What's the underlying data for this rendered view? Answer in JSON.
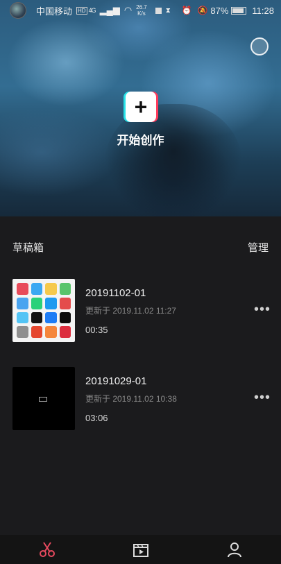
{
  "status_bar": {
    "carrier": "中国移动",
    "network_badge": "HD",
    "signal": "4G",
    "speed_value": "26.7",
    "speed_unit": "K/s",
    "battery": "87%",
    "battery_level": 0.87,
    "time": "11:28"
  },
  "hero": {
    "create_icon": "plus-icon",
    "create_label": "开始创作",
    "theme_icon": "moon-icon"
  },
  "drafts": {
    "title": "草稿箱",
    "manage_label": "管理",
    "items": [
      {
        "name": "20191102-01",
        "updated": "更新于 2019.11.02 11:27",
        "duration": "00:35"
      },
      {
        "name": "20191029-01",
        "updated": "更新于 2019.11.02 10:38",
        "duration": "03:06"
      }
    ]
  },
  "tabbar": {
    "tabs": [
      {
        "icon": "scissors-icon",
        "active": true,
        "color": "#e84a5f"
      },
      {
        "icon": "clapperboard-icon",
        "active": false,
        "color": "#dddddd"
      },
      {
        "icon": "person-icon",
        "active": false,
        "color": "#dddddd"
      }
    ]
  }
}
